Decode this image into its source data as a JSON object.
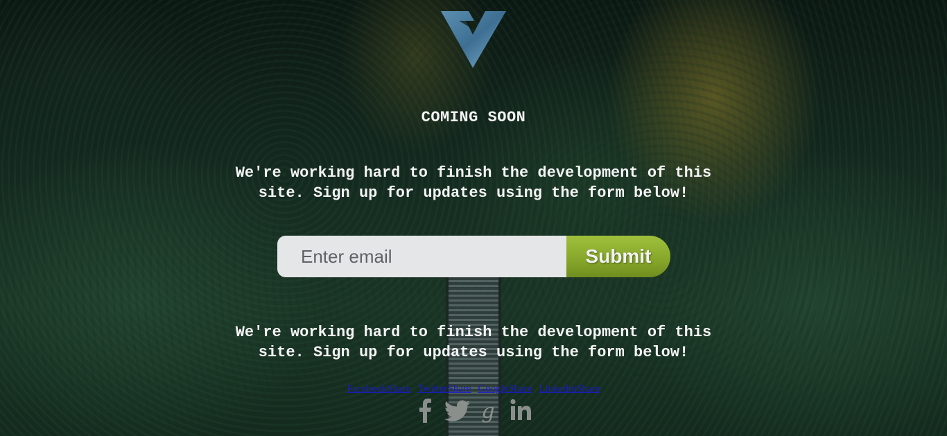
{
  "header": {
    "logo_name": "v-logo",
    "title": "COMING SOON"
  },
  "main": {
    "message_top": "We're working hard to finish the development of this site. Sign up for updates using the form below!",
    "message_bottom": "We're working hard to finish the development of this site. Sign up for updates using the form below!",
    "form": {
      "email_placeholder": "Enter email",
      "email_value": "",
      "submit_label": "Submit"
    }
  },
  "footer": {
    "share_links": [
      {
        "label": "FacebookShare"
      },
      {
        "label": "TwitterShare"
      },
      {
        "label": "GoogleShare"
      },
      {
        "label": "LinkedinShare"
      }
    ],
    "social_icons": [
      "facebook-icon",
      "twitter-icon",
      "google-plus-icon",
      "linkedin-icon"
    ]
  },
  "colors": {
    "accent": "#86a62b",
    "text": "#f4f4f4",
    "input_bg": "#e5e6e7",
    "link": "#1a1acc"
  }
}
